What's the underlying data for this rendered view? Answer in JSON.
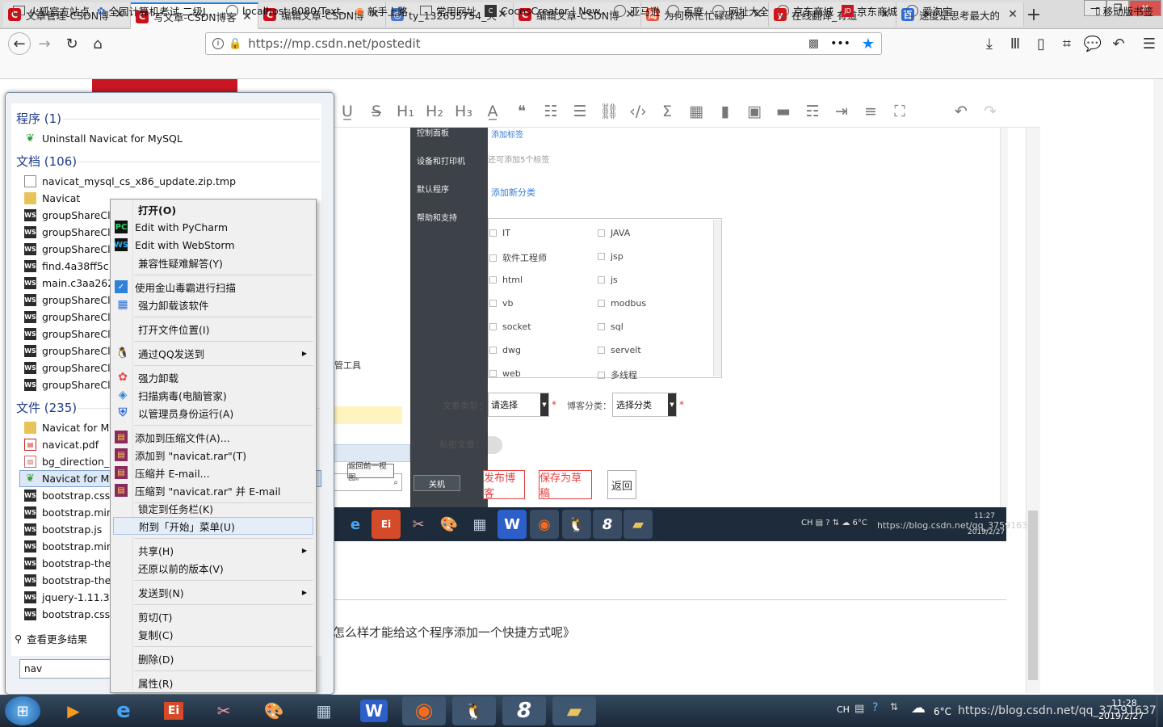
{
  "browser": {
    "tabs": [
      {
        "title": "文章管理-CSDN博",
        "icon": "C",
        "color": "#c8111a"
      },
      {
        "title": "写文章-CSDN博客",
        "icon": "C",
        "color": "#c8111a"
      },
      {
        "title": "编辑文章-CSDN博",
        "icon": "C",
        "color": "#c8111a"
      },
      {
        "title": "ty_132655754_天",
        "icon": "◎",
        "color": "#4a78c8"
      },
      {
        "title": "编辑文章-CSDN博",
        "icon": "C",
        "color": "#c8111a"
      },
      {
        "title": "为何你忙忙碌碌却",
        "icon": "简",
        "color": "#e35b42"
      },
      {
        "title": "在线翻译_有道",
        "icon": "y",
        "color": "#d3151a"
      },
      {
        "title": "速度是思考最大的",
        "icon": "百",
        "color": "#2f6ed8"
      }
    ],
    "new_tab": "+",
    "url": "https://mp.csdn.net/postedit",
    "url_host": "mp.csdn.net",
    "bookmarks": [
      "火狐官方站点",
      "全国计算机考试 二级J...",
      "localhost:8080/Text...",
      "新手上路",
      "常用网址",
      "CocosCreator | New...",
      "亚马逊",
      "百度",
      "网址大全",
      "京东商城",
      "京东商城",
      "爱淘宝"
    ],
    "mobile_bookmarks": "移动版书签"
  },
  "start_menu": {
    "programs_header": "程序 (1)",
    "programs": [
      "Uninstall Navicat for MySQL"
    ],
    "docs_header": "文档 (106)",
    "docs": [
      "navicat_mysql_cs_x86_update.zip.tmp",
      "Navicat",
      "groupShareCli",
      "groupShareCli",
      "groupShareCli",
      "find.4a38ff5c.js",
      "main.c3aa262b",
      "groupShareCli",
      "groupShareCli",
      "groupShareCli",
      "groupShareCli",
      "groupShareCli",
      "groupShareCli"
    ],
    "files_header": "文件 (235)",
    "files": [
      "Navicat for My",
      "navicat.pdf",
      "bg_direction_n",
      "Navicat for My",
      "bootstrap.css",
      "bootstrap.min.",
      "bootstrap.js",
      "bootstrap.min.",
      "bootstrap-ther",
      "bootstrap-ther",
      "jquery-1.11.3.n",
      "bootstrap.css"
    ],
    "more_results": "查看更多结果",
    "search_value": "nav"
  },
  "context_menu": {
    "items": [
      {
        "label": "打开(O)",
        "bold": true
      },
      {
        "label": "Edit with PyCharm",
        "icon": "PC"
      },
      {
        "label": "Edit with WebStorm",
        "icon": "WS"
      },
      {
        "label": "兼容性疑难解答(Y)"
      },
      {
        "label": "使用金山毒霸进行扫描",
        "icon": "✓"
      },
      {
        "label": "强力卸载该软件",
        "icon": "▦"
      },
      {
        "label": "打开文件位置(I)"
      },
      {
        "label": "通过QQ发送到",
        "icon": "🐧",
        "sub": true
      },
      {
        "label": "强力卸载",
        "icon": "✿"
      },
      {
        "label": "扫描病毒(电脑管家)",
        "icon": "◈"
      },
      {
        "label": "以管理员身份运行(A)",
        "icon": "⛨"
      },
      {
        "label": "添加到压缩文件(A)...",
        "icon": "▤"
      },
      {
        "label": "添加到 \"navicat.rar\"(T)",
        "icon": "▤"
      },
      {
        "label": "压缩并 E-mail...",
        "icon": "▤"
      },
      {
        "label": "压缩到 \"navicat.rar\" 并 E-mail",
        "icon": "▤"
      },
      {
        "label": "锁定到任务栏(K)"
      },
      {
        "label": "附到「开始」菜单(U)"
      },
      {
        "label": "共享(H)",
        "sub": true
      },
      {
        "label": "还原以前的版本(V)"
      },
      {
        "label": "发送到(N)",
        "sub": true
      },
      {
        "label": "剪切(T)"
      },
      {
        "label": "复制(C)"
      },
      {
        "label": "删除(D)"
      },
      {
        "label": "属性(R)"
      }
    ],
    "highlighted": "附到「开始」菜单(U)"
  },
  "editor": {
    "inner_menu": [
      "控制面板",
      "设备和打印机",
      "默认程序",
      "帮助和支持"
    ],
    "add_tag_link": "添加标签",
    "tag_hint": "还可添加5个标签",
    "add_category_link": "添加新分类",
    "categories_left": [
      "IT",
      "软件工程师",
      "html",
      "vb",
      "socket",
      "dwg",
      "web"
    ],
    "categories_right": [
      "JAVA",
      "jsp",
      "js",
      "modbus",
      "sql",
      "servelt",
      "多线程"
    ],
    "article_type_label": "文章类型：",
    "article_type_value": "请选择",
    "blog_cat_label": "博客分类：",
    "blog_cat_value": "选择分类",
    "private_label": "私密文章：",
    "publish_btn": "发布博客",
    "draft_btn": "保存为草稿",
    "back_btn": "返回",
    "tooltip": "返回前一视图。",
    "shutdown": "关机",
    "left_fragment": "管工具",
    "body_text": "怎么样才能给这个程序添加一个快捷方式呢》",
    "inner_tray_time": "11:27",
    "inner_tray_date": "2019/2/27",
    "inner_tray_watermark": "https://blog.csdn.net/qq_37591637"
  },
  "taskbar": {
    "lang": "CH",
    "weather": "6°C",
    "watermark": "https://blog.csdn.net/qq_37591637",
    "time": "11:28",
    "date": "2019/2/27"
  }
}
